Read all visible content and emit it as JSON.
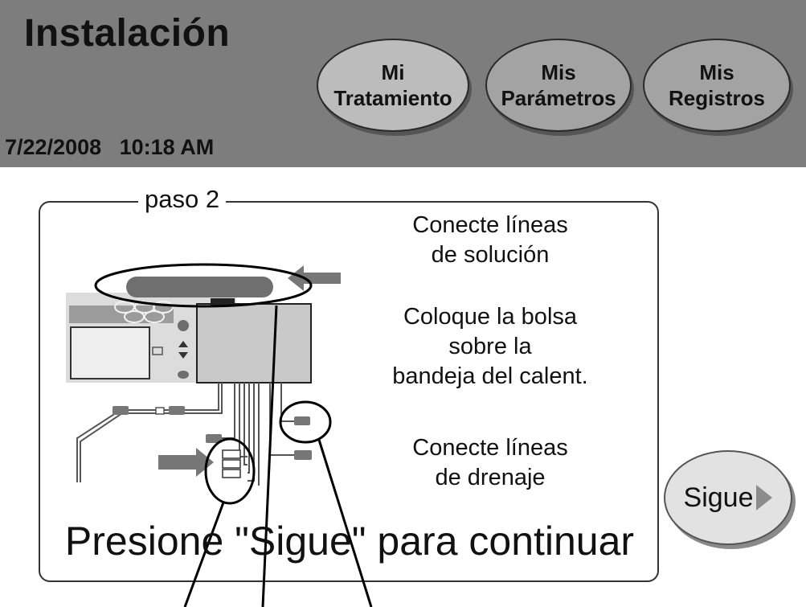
{
  "header": {
    "title": "Instalación",
    "date": "7/22/2008",
    "time": "10:18 AM",
    "nav": [
      {
        "label": "Mi\nTratamiento"
      },
      {
        "label": "Mis\nParámetros"
      },
      {
        "label": "Mis\nRegistros"
      }
    ]
  },
  "step": {
    "label": "paso 2",
    "instructions": [
      "Conecte líneas\nde solución",
      "Coloque la bolsa\nsobre la\nbandeja del calent.",
      "Conecte líneas\nde drenaje"
    ],
    "prompt": "Presione \"Sigue\" para continuar"
  },
  "next_button": {
    "label": "Sigue",
    "icon": "play-arrow-icon"
  },
  "colors": {
    "header_bg": "#7d7d7d",
    "active_tab": "#bcbcbc",
    "inactive_tab": "#a3a3a3"
  }
}
